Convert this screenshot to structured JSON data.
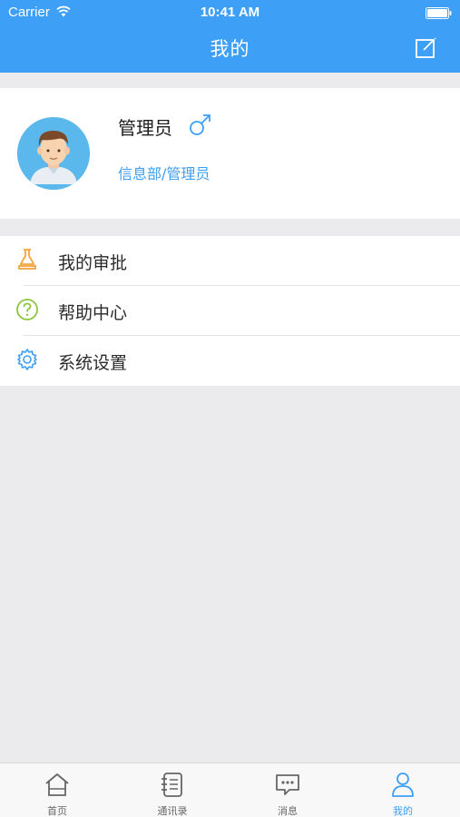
{
  "status_bar": {
    "carrier": "Carrier",
    "time": "10:41 AM"
  },
  "header": {
    "title": "我的",
    "edit_icon": "edit-icon"
  },
  "profile": {
    "name": "管理员",
    "gender_icon": "male-icon",
    "department": "信息部/管理员"
  },
  "menu": {
    "items": [
      {
        "label": "我的审批",
        "icon": "approval-icon",
        "color": "#F5A43B"
      },
      {
        "label": "帮助中心",
        "icon": "help-icon",
        "color": "#8CC63F"
      },
      {
        "label": "系统设置",
        "icon": "settings-icon",
        "color": "#3D9FF6"
      }
    ]
  },
  "tabbar": {
    "tabs": [
      {
        "label": "首页",
        "icon": "home-icon",
        "active": false
      },
      {
        "label": "通讯录",
        "icon": "contacts-icon",
        "active": false
      },
      {
        "label": "消息",
        "icon": "message-icon",
        "active": false
      },
      {
        "label": "我的",
        "icon": "user-icon",
        "active": true
      }
    ]
  },
  "colors": {
    "accent": "#3D9FF6",
    "background": "#EBEBED"
  }
}
